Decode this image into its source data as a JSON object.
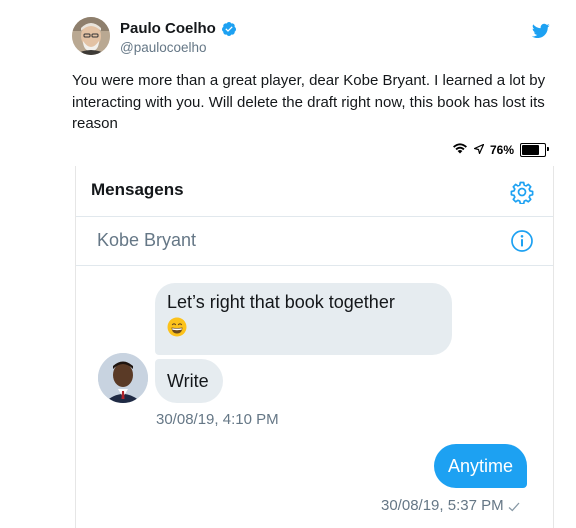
{
  "tweet": {
    "author_name": "Paulo Coelho",
    "author_handle": "@paulocoelho",
    "verified": true,
    "text": "You were more than a great player, dear Kobe Bryant. I learned a lot by interacting with you. Will delete the draft right now, this book has lost its reason"
  },
  "screenshot": {
    "status_bar": {
      "battery": "76%",
      "battery_level": 0.76
    },
    "header": {
      "title": "Mensagens"
    },
    "conversation": {
      "contact_name": "Kobe Bryant"
    },
    "messages": {
      "incoming_1": "Let’s right that book together",
      "incoming_1_emoji": "grinning-face-emoji",
      "incoming_2": "Write",
      "incoming_time": "30/08/19, 4:10 PM",
      "outgoing_1": "Anytime",
      "outgoing_time": "30/08/19, 5:37 PM"
    }
  },
  "colors": {
    "twitter_blue": "#1da1f2",
    "bubble_gray": "#e6ecf0",
    "secondary_text": "#657786"
  },
  "icons": [
    "verified-icon",
    "twitter-bird-icon",
    "wifi-icon",
    "location-arrow-icon",
    "battery-icon",
    "gear-icon",
    "info-icon",
    "check-icon"
  ]
}
